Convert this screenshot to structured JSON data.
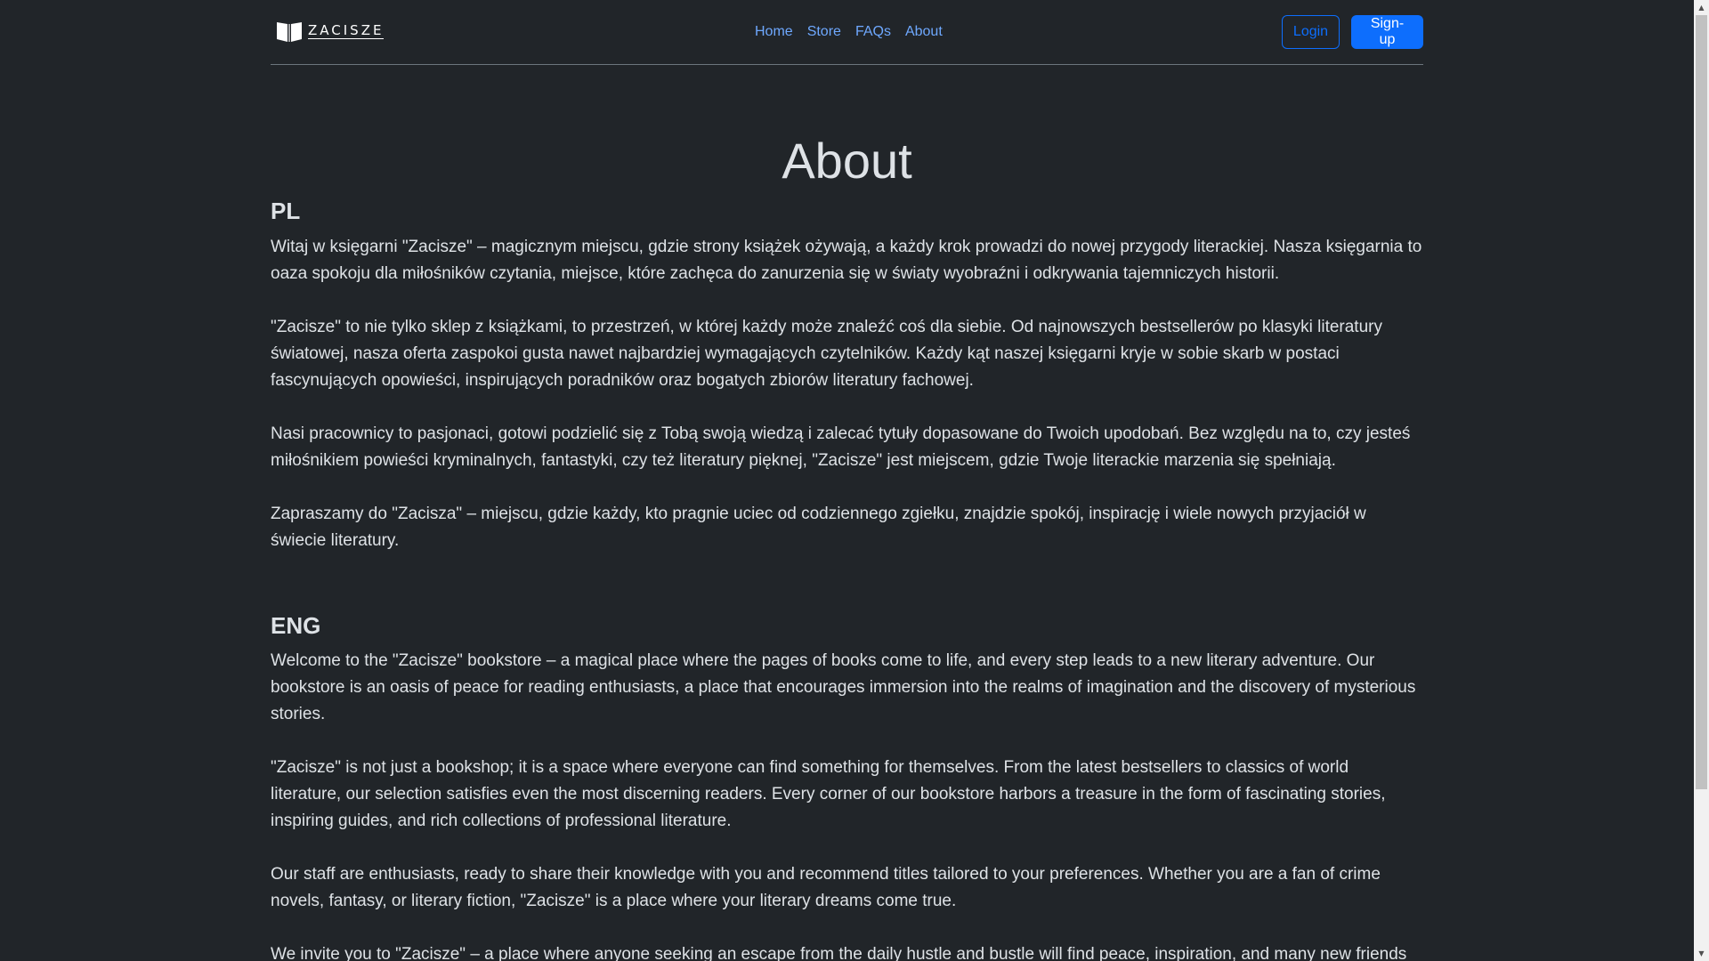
{
  "header": {
    "brand": "ZACISZE",
    "nav": [
      "Home",
      "Store",
      "FAQs",
      "About"
    ],
    "login_label": "Login",
    "signup_label": "Sign-up"
  },
  "main": {
    "title": "About",
    "pl": {
      "heading": "PL",
      "paragraphs": [
        "Witaj w księgarni \"Zacisze\" – magicznym miejscu, gdzie strony książek ożywają, a każdy krok prowadzi do nowej przygody literackiej. Nasza księgarnia to oaza spokoju dla miłośników czytania, miejsce, które zachęca do zanurzenia się w światy wyobraźni i odkrywania tajemniczych historii.",
        "\"Zacisze\" to nie tylko sklep z książkami, to przestrzeń, w której każdy może znaleźć coś dla siebie. Od najnowszych bestsellerów po klasyki literatury światowej, nasza oferta zaspokoi gusta nawet najbardziej wymagających czytelników. Każdy kąt naszej księgarni kryje w sobie skarb w postaci fascynujących opowieści, inspirujących poradników oraz bogatych zbiorów literatury fachowej.",
        "Nasi pracownicy to pasjonaci, gotowi podzielić się z Tobą swoją wiedzą i zalecać tytuły dopasowane do Twoich upodobań. Bez względu na to, czy jesteś miłośnikiem powieści kryminalnych, fantastyki, czy też literatury pięknej, \"Zacisze\" jest miejscem, gdzie Twoje literackie marzenia się spełniają.",
        "Zapraszamy do \"Zacisza\" – miejscu, gdzie każdy, kto pragnie uciec od codziennego zgiełku, znajdzie spokój, inspirację i wiele nowych przyjaciół w świecie literatury."
      ]
    },
    "eng": {
      "heading": "ENG",
      "paragraphs": [
        "Welcome to the \"Zacisze\" bookstore – a magical place where the pages of books come to life, and every step leads to a new literary adventure. Our bookstore is an oasis of peace for reading enthusiasts, a place that encourages immersion into the realms of imagination and the discovery of mysterious stories.",
        "\"Zacisze\" is not just a bookshop; it is a space where everyone can find something for themselves. From the latest bestsellers to classics of world literature, our selection satisfies even the most discerning readers. Every corner of our bookstore harbors a treasure in the form of fascinating stories, inspiring guides, and rich collections of professional literature.",
        "Our staff are enthusiasts, ready to share their knowledge with you and recommend titles tailored to your preferences. Whether you are a fan of crime novels, fantasy, or literary fiction, \"Zacisze\" is a place where your literary dreams come true.",
        "We invite you to \"Zacisze\" – a place where anyone seeking an escape from the daily hustle and bustle will find peace, inspiration, and many new friends in"
      ]
    }
  },
  "icons": {
    "logo": "open-book-icon",
    "scroll_up": "chevron-up-icon",
    "scroll_down": "chevron-down-icon"
  },
  "colors": {
    "background": "#212529",
    "text": "#dee2e6",
    "link": "#6ea8fe",
    "primary": "#0d6efd"
  }
}
